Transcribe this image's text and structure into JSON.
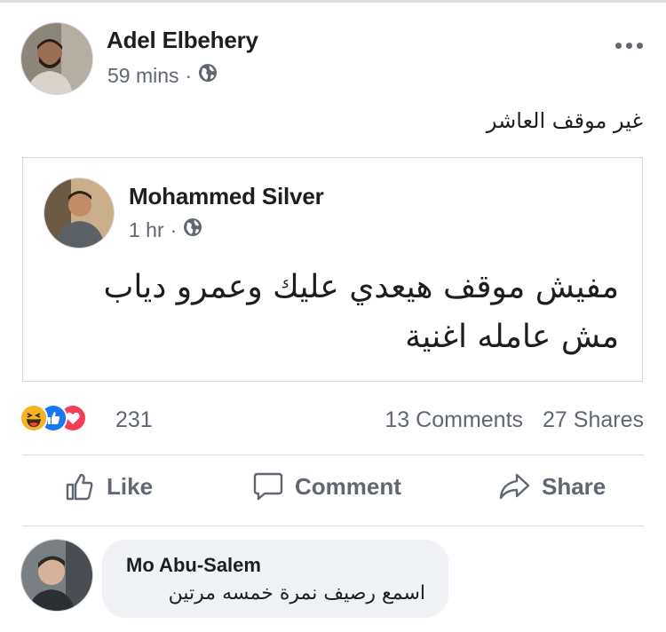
{
  "post": {
    "author": "Adel Elbehery",
    "time": "59 mins",
    "separator": "·",
    "text": "غير موقف العاشر"
  },
  "shared_post": {
    "author": "Mohammed Silver",
    "time": "1 hr",
    "separator": "·",
    "text": "مفيش موقف هيعدي عليك وعمرو دياب مش عامله اغنية"
  },
  "engagement": {
    "reaction_count": "231",
    "comments": "13 Comments",
    "shares": "27 Shares",
    "reaction_icons": [
      "haha-reaction-icon",
      "like-reaction-icon",
      "love-reaction-icon"
    ]
  },
  "actions": {
    "like": "Like",
    "comment": "Comment",
    "share": "Share"
  },
  "comment": {
    "author": "Mo Abu-Salem",
    "text": "اسمع رصيف نمرة خمسه مرتين"
  },
  "colors": {
    "meta_gray": "#606770",
    "like_blue": "#1877f2",
    "love_red": "#f33e58",
    "haha_yellow": "#f7b125",
    "bubble_gray": "#f0f2f5"
  }
}
